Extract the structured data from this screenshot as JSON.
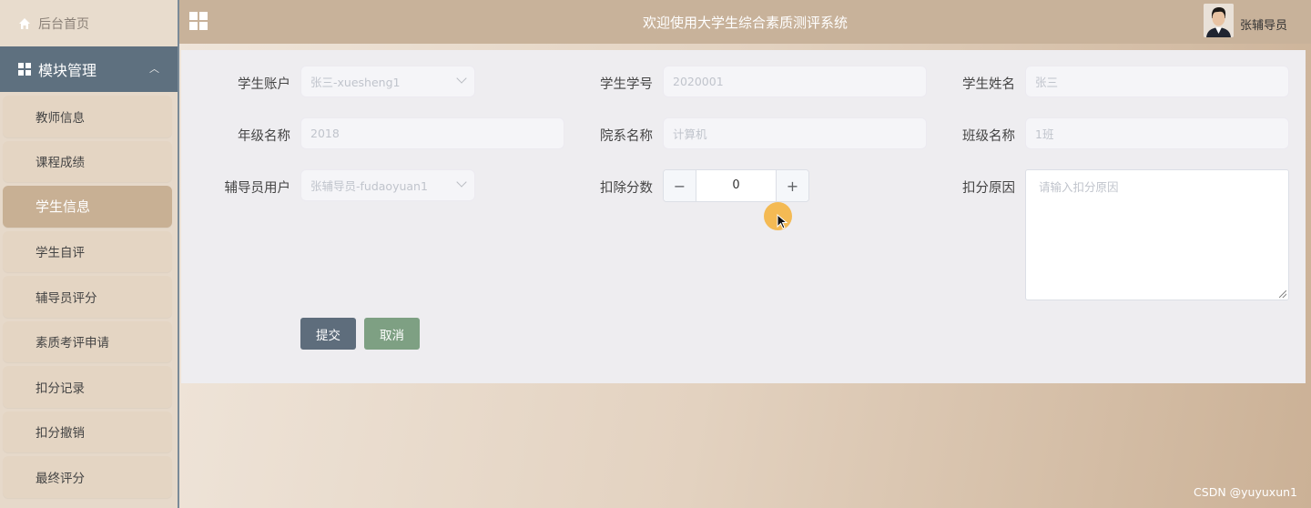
{
  "sidebar": {
    "home_label": "后台首页",
    "module_label": "模块管理",
    "items": [
      {
        "label": "教师信息",
        "active": false
      },
      {
        "label": "课程成绩",
        "active": false
      },
      {
        "label": "学生信息",
        "active": true
      },
      {
        "label": "学生自评",
        "active": false
      },
      {
        "label": "辅导员评分",
        "active": false
      },
      {
        "label": "素质考评申请",
        "active": false
      },
      {
        "label": "扣分记录",
        "active": false
      },
      {
        "label": "扣分撤销",
        "active": false
      },
      {
        "label": "最终评分",
        "active": false
      }
    ]
  },
  "header": {
    "title": "欢迎使用大学生综合素质测评系统",
    "user_name": "张辅导员",
    "icons": [
      "menu-grid-icon",
      "user-avatar"
    ]
  },
  "form": {
    "student_account": {
      "label": "学生账户",
      "value": "张三-xuesheng1"
    },
    "student_id": {
      "label": "学生学号",
      "value": "2020001"
    },
    "student_name": {
      "label": "学生姓名",
      "value": "张三"
    },
    "grade": {
      "label": "年级名称",
      "value": "2018"
    },
    "department": {
      "label": "院系名称",
      "value": "计算机"
    },
    "class_name": {
      "label": "班级名称",
      "value": "1班"
    },
    "counselor": {
      "label": "辅导员用户",
      "value": "张辅导员-fudaoyuan1"
    },
    "deduct_points": {
      "label": "扣除分数",
      "value": "0",
      "minus": "−",
      "plus": "+"
    },
    "deduct_reason": {
      "label": "扣分原因",
      "placeholder": "请输入扣分原因"
    },
    "submit_label": "提交",
    "cancel_label": "取消"
  },
  "colors": {
    "sidebar_active": "#c8b094",
    "module_bar": "#5e707f",
    "header": "#c8b29a",
    "submit": "#5e6d7c",
    "cancel": "#7ea083"
  },
  "watermark": "CSDN @yuyuxun1"
}
